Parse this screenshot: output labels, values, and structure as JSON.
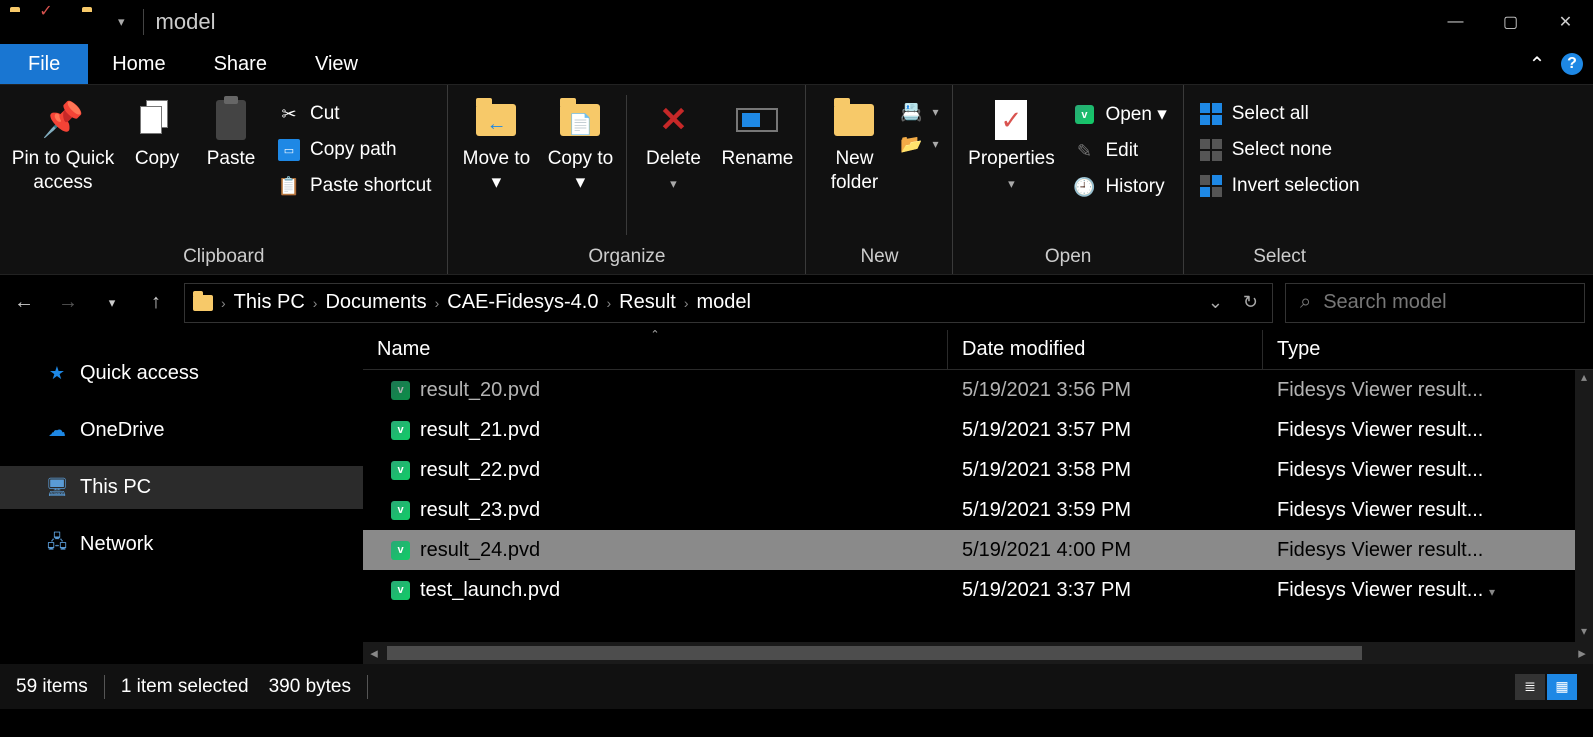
{
  "window": {
    "title": "model"
  },
  "tabs": {
    "file": "File",
    "home": "Home",
    "share": "Share",
    "view": "View"
  },
  "ribbon": {
    "clipboard": {
      "label": "Clipboard",
      "pin": "Pin to Quick access",
      "copy": "Copy",
      "paste": "Paste",
      "cut": "Cut",
      "copypath": "Copy path",
      "pasteshortcut": "Paste shortcut"
    },
    "organize": {
      "label": "Organize",
      "moveto": "Move to ▾",
      "copyto": "Copy to ▾",
      "delete": "Delete",
      "delete_drop": "▾",
      "rename": "Rename"
    },
    "new": {
      "label": "New",
      "newfolder": "New folder",
      "newitem_drop": "▾",
      "easy_drop": "▾"
    },
    "open": {
      "label": "Open",
      "properties": "Properties",
      "properties_drop": "▾",
      "open": "Open ▾",
      "edit": "Edit",
      "history": "History"
    },
    "select": {
      "label": "Select",
      "all": "Select all",
      "none": "Select none",
      "invert": "Invert selection"
    }
  },
  "breadcrumb": [
    "This PC",
    "Documents",
    "CAE-Fidesys-4.0",
    "Result",
    "model"
  ],
  "search": {
    "placeholder": "Search model"
  },
  "navpane": {
    "quick": "Quick access",
    "onedrive": "OneDrive",
    "thispc": "This PC",
    "network": "Network"
  },
  "columns": {
    "name": "Name",
    "date": "Date modified",
    "type": "Type"
  },
  "files": [
    {
      "name": "result_20.pvd",
      "date": "5/19/2021 3:56 PM",
      "type": "Fidesys Viewer result...",
      "cut": true
    },
    {
      "name": "result_21.pvd",
      "date": "5/19/2021 3:57 PM",
      "type": "Fidesys Viewer result..."
    },
    {
      "name": "result_22.pvd",
      "date": "5/19/2021 3:58 PM",
      "type": "Fidesys Viewer result..."
    },
    {
      "name": "result_23.pvd",
      "date": "5/19/2021 3:59 PM",
      "type": "Fidesys Viewer result..."
    },
    {
      "name": "result_24.pvd",
      "date": "5/19/2021 4:00 PM",
      "type": "Fidesys Viewer result...",
      "selected": true
    },
    {
      "name": "test_launch.pvd",
      "date": "5/19/2021 3:37 PM",
      "type": "Fidesys Viewer result...",
      "last": true
    }
  ],
  "status": {
    "count": "59 items",
    "selected": "1 item selected",
    "size": "390 bytes"
  }
}
